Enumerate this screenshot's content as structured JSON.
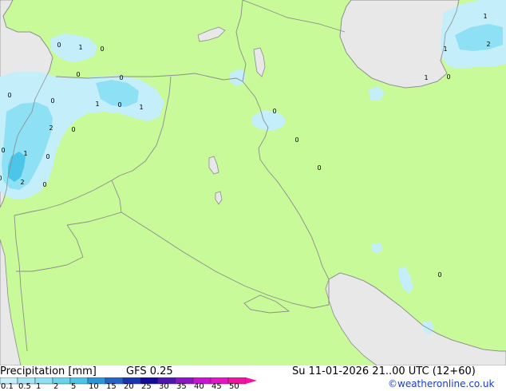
{
  "title": "Precipitation [mm]",
  "model": "GFS 0.25",
  "valid_time": "Su 11-01-2026 21..00 UTC (12+60)",
  "credit": "©weatheronline.co.uk",
  "colors": {
    "land": "#c8fa9a",
    "sea": "#e8e8e8",
    "border": "#8c8c8c",
    "precip_light": "#c4eefa",
    "precip_mid": "#8ee0f4",
    "precip_heavy": "#4cc6e8"
  },
  "scale": [
    {
      "label": "0.1",
      "color": "#c4eefa"
    },
    {
      "label": "0.5",
      "color": "#a2e6f6"
    },
    {
      "label": "1",
      "color": "#8ee0f4"
    },
    {
      "label": "2",
      "color": "#6ad4ee"
    },
    {
      "label": "5",
      "color": "#4cc6e8"
    },
    {
      "label": "10",
      "color": "#2a96dc"
    },
    {
      "label": "15",
      "color": "#2264c8"
    },
    {
      "label": "20",
      "color": "#1a34b4"
    },
    {
      "label": "25",
      "color": "#140a9e"
    },
    {
      "label": "30",
      "color": "#5014b4"
    },
    {
      "label": "35",
      "color": "#8c14c8"
    },
    {
      "label": "40",
      "color": "#c814d2"
    },
    {
      "label": "45",
      "color": "#e614c8"
    },
    {
      "label": "50",
      "color": "#f014a0"
    }
  ],
  "values": [
    {
      "label": "0"
    },
    {
      "label": "1"
    },
    {
      "label": "0"
    },
    {
      "label": "0"
    },
    {
      "label": "0"
    },
    {
      "label": "0"
    },
    {
      "label": "0"
    },
    {
      "label": "1"
    },
    {
      "label": "0"
    },
    {
      "label": "1"
    },
    {
      "label": "2"
    },
    {
      "label": "0"
    },
    {
      "label": "1"
    },
    {
      "label": "0"
    },
    {
      "label": "0"
    },
    {
      "label": "2"
    },
    {
      "label": "0"
    },
    {
      "label": "0"
    },
    {
      "label": "0"
    },
    {
      "label": "0"
    },
    {
      "label": "0"
    },
    {
      "label": "1"
    },
    {
      "label": "1"
    },
    {
      "label": "2"
    },
    {
      "label": "1"
    },
    {
      "label": "0"
    },
    {
      "label": "0"
    }
  ]
}
